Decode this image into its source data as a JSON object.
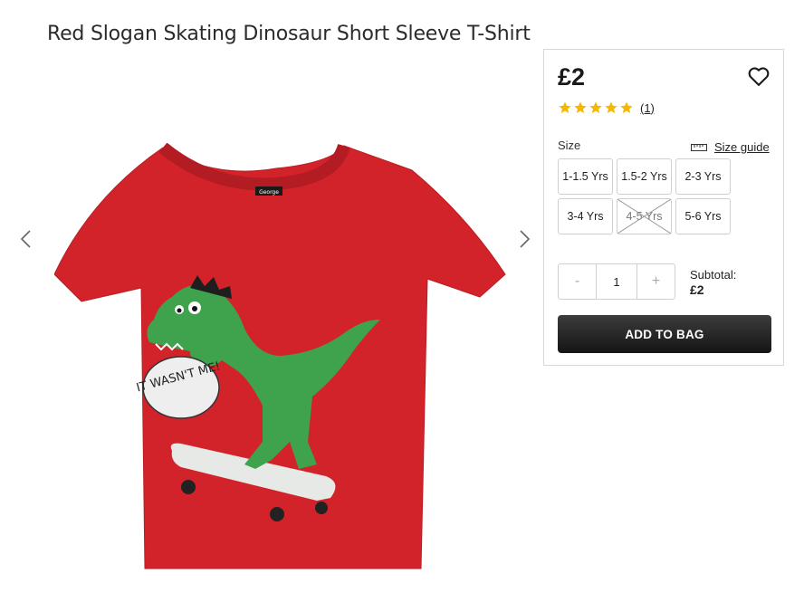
{
  "product": {
    "title": "Red Slogan Skating Dinosaur Short Sleeve T-Shirt",
    "price": "£2",
    "rating": {
      "stars": 5,
      "count_label": "(1)"
    },
    "speech_text": "IT WASN'T ME!",
    "brand_tag": "George"
  },
  "size": {
    "label": "Size",
    "guide_label": "Size guide",
    "options": [
      {
        "label": "1-1.5 Yrs",
        "available": true
      },
      {
        "label": "1.5-2 Yrs",
        "available": true
      },
      {
        "label": "2-3 Yrs",
        "available": true
      },
      {
        "label": "3-4 Yrs",
        "available": true
      },
      {
        "label": "4-5 Yrs",
        "available": false
      },
      {
        "label": "5-6 Yrs",
        "available": true
      }
    ]
  },
  "quantity": {
    "minus": "-",
    "value": "1",
    "plus": "+"
  },
  "subtotal": {
    "label": "Subtotal:",
    "value": "£2"
  },
  "add_to_bag": "ADD TO BAG",
  "colors": {
    "shirt": "#d3232a",
    "dino": "#3fa34d",
    "star": "#f5b800",
    "button": "#222222"
  }
}
